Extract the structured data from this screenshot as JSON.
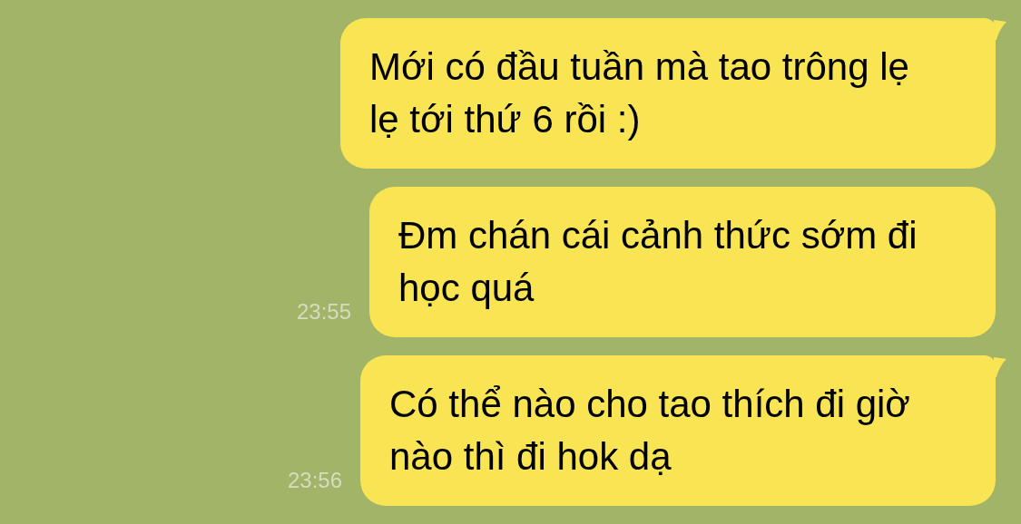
{
  "messages": [
    {
      "text": "Mới có đầu tuần mà tao trông lẹ lẹ tới thứ 6 rồi :)",
      "tail": true
    },
    {
      "text": "Đm chán cái cảnh thức sớm đi học quá",
      "time": "23:55",
      "tail": false
    },
    {
      "text": "Có thể nào cho tao thích đi giờ nào thì đi hok dạ",
      "time": "23:56",
      "tail": true
    }
  ]
}
